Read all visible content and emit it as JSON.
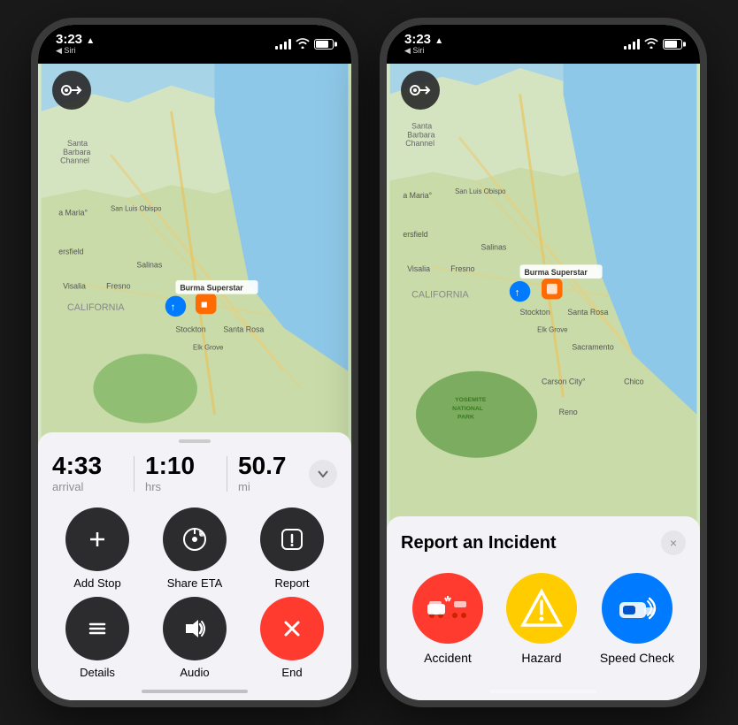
{
  "phone1": {
    "status": {
      "time": "3:23",
      "time_arrow": "▲",
      "siri": "◀ Siri"
    },
    "nav_button_icon": "⊙→",
    "nav_info": {
      "arrival_value": "4:33",
      "arrival_label": "arrival",
      "hrs_value": "1:10",
      "hrs_label": "hrs",
      "mi_value": "50.7",
      "mi_label": "mi"
    },
    "actions": [
      {
        "id": "add-stop",
        "label": "Add Stop",
        "icon": "+",
        "color": "dark"
      },
      {
        "id": "share-eta",
        "label": "Share ETA",
        "icon": "share-eta",
        "color": "dark"
      },
      {
        "id": "report",
        "label": "Report",
        "icon": "!",
        "color": "dark"
      },
      {
        "id": "details",
        "label": "Details",
        "icon": "list",
        "color": "dark"
      },
      {
        "id": "audio",
        "label": "Audio",
        "icon": "audio",
        "color": "dark"
      },
      {
        "id": "end",
        "label": "End",
        "icon": "×",
        "color": "red"
      }
    ]
  },
  "phone2": {
    "status": {
      "time": "3:23",
      "siri": "◀ Siri"
    },
    "nav_button_icon": "⊙→",
    "incident_panel": {
      "title": "Report an Incident",
      "close_label": "×",
      "items": [
        {
          "id": "accident",
          "label": "Accident",
          "icon": "🚗",
          "color": "red"
        },
        {
          "id": "hazard",
          "label": "Hazard",
          "icon": "⚠",
          "color": "yellow"
        },
        {
          "id": "speed-check",
          "label": "Speed Check",
          "icon": "📷",
          "color": "blue"
        }
      ]
    }
  },
  "map": {
    "destination": "Burma Superstar",
    "location_pin_color": "#007aff",
    "destination_pin_color": "#ff6b00"
  }
}
